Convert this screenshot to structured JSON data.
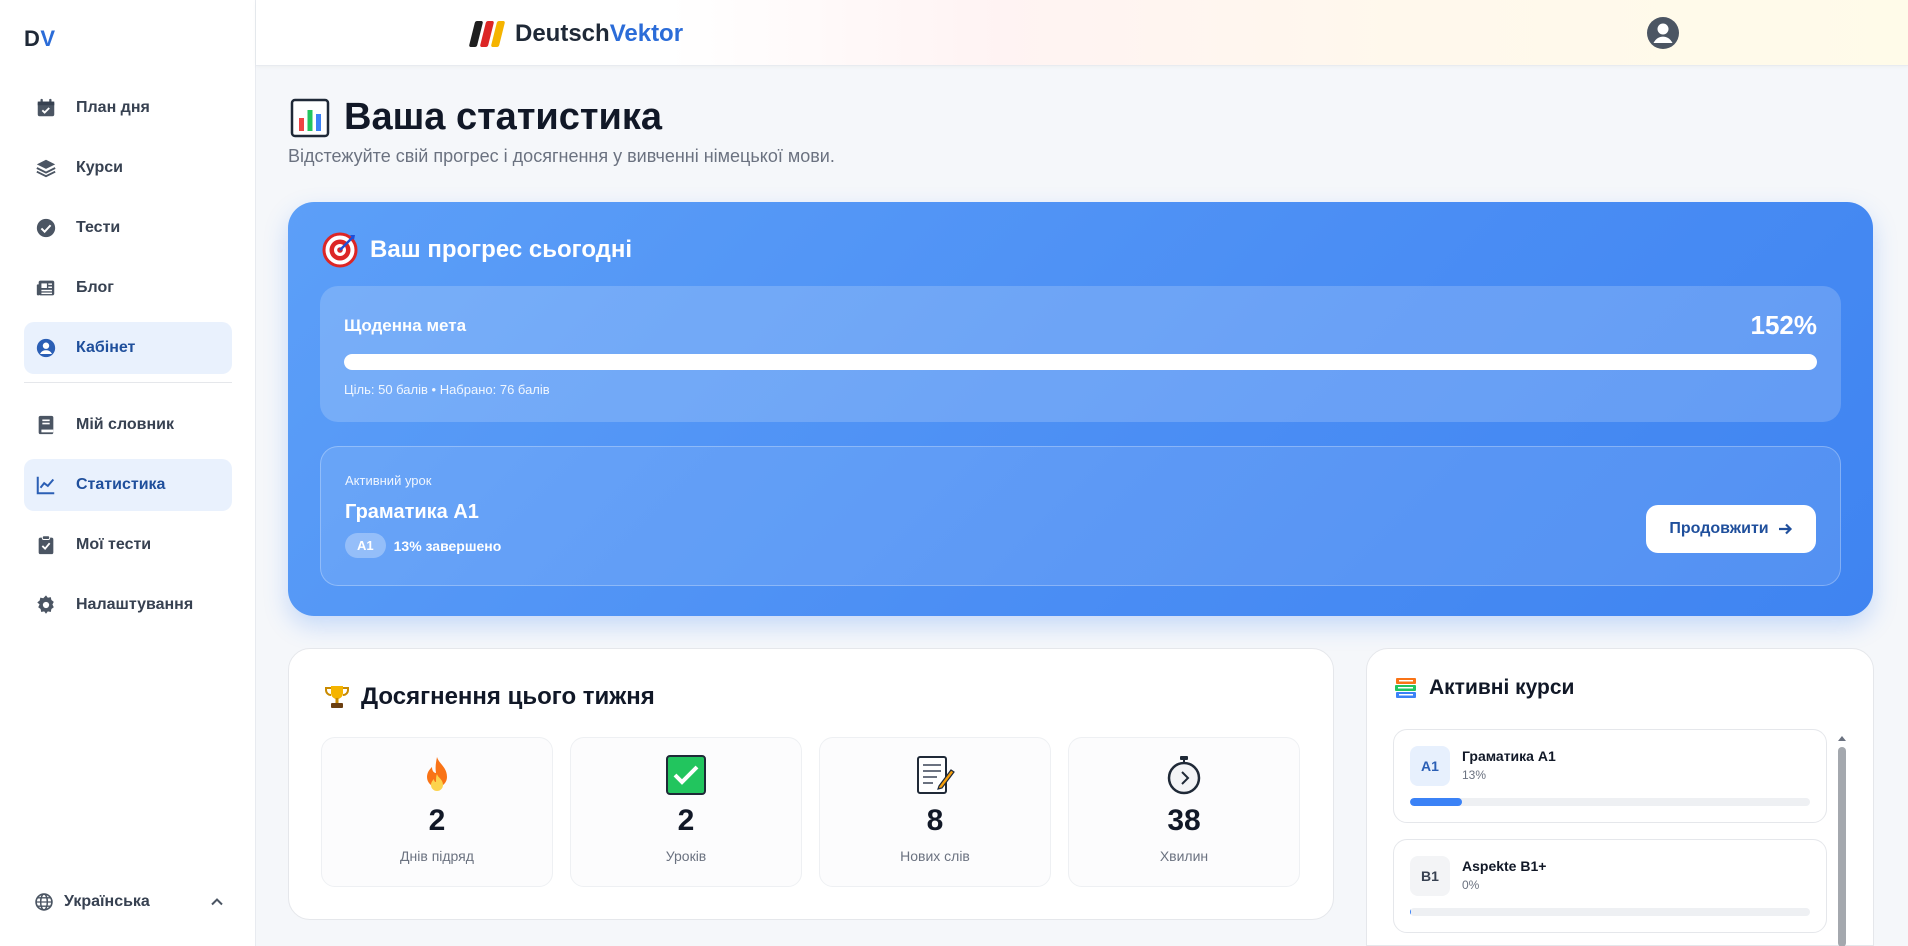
{
  "sidebar": {
    "logo": {
      "d": "D",
      "v": "V"
    },
    "items": [
      {
        "label": "План дня",
        "icon": "calendar-check-icon"
      },
      {
        "label": "Курси",
        "icon": "layers-icon"
      },
      {
        "label": "Тести",
        "icon": "check-circle-icon"
      },
      {
        "label": "Блог",
        "icon": "newspaper-icon"
      },
      {
        "label": "Кабінет",
        "icon": "user-circle-icon"
      },
      {
        "label": "Мій словник",
        "icon": "book-icon"
      },
      {
        "label": "Статистика",
        "icon": "chart-line-icon"
      },
      {
        "label": "Мої тести",
        "icon": "clipboard-check-icon"
      },
      {
        "label": "Налаштування",
        "icon": "gear-icon"
      }
    ],
    "language": "Українська"
  },
  "header": {
    "brand_part1": "Deutsch",
    "brand_part2": "Vektor"
  },
  "page": {
    "title": "Ваша статистика",
    "subtitle": "Відстежуйте свій прогрес і досягнення у вивченні німецької мови."
  },
  "today": {
    "title": "Ваш прогрес сьогодні",
    "goal_label": "Щоденна мета",
    "goal_percent": "152%",
    "goal_fill_fraction": 1.0,
    "goal_note": "Ціль: 50 балів • Набрано: 76 балів",
    "lesson_kicker": "Активний урок",
    "lesson_name": "Граматика A1",
    "lesson_level": "A1",
    "lesson_progress": "13% завершено",
    "continue_label": "Продовжити"
  },
  "achievements": {
    "title": "Досягнення цього тижня",
    "stats": [
      {
        "value": "2",
        "label": "Днів підряд",
        "icon": "fire-icon"
      },
      {
        "value": "2",
        "label": "Уроків",
        "icon": "checkmark-box-icon"
      },
      {
        "value": "8",
        "label": "Нових слів",
        "icon": "memo-icon"
      },
      {
        "value": "38",
        "label": "Хвилин",
        "icon": "stopwatch-icon"
      }
    ]
  },
  "courses": {
    "title": "Активні курси",
    "items": [
      {
        "level": "A1",
        "name": "Граматика A1",
        "percent": "13%",
        "fraction": 0.13
      },
      {
        "level": "B1",
        "name": "Aspekte B1+",
        "percent": "0%",
        "fraction": 0.0
      }
    ]
  },
  "colors": {
    "accent": "#3b82f6",
    "brand_blue": "#2b6cd8",
    "sidebar_active_bg": "#e9f1fd"
  }
}
